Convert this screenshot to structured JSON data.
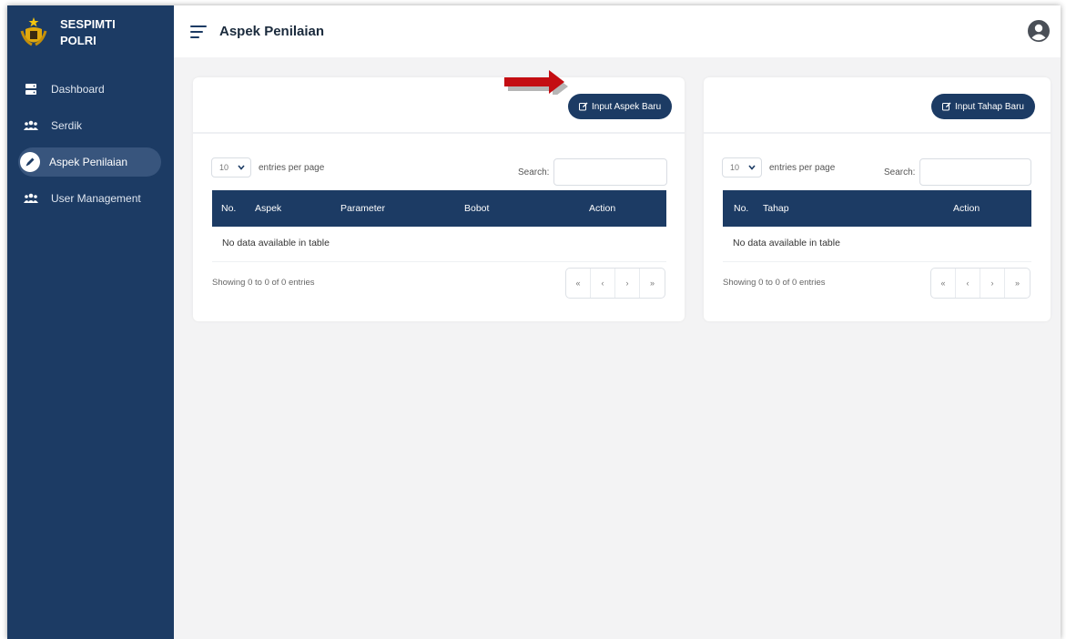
{
  "brand": {
    "line1": "SESPIMTI",
    "line2": "POLRI"
  },
  "header": {
    "title": "Aspek Penilaian"
  },
  "sidebar": {
    "items": [
      {
        "label": "Dashboard",
        "icon": "server-icon"
      },
      {
        "label": "Serdik",
        "icon": "users-icon"
      },
      {
        "label": "Aspek Penilaian",
        "icon": "pen-icon",
        "active": true
      },
      {
        "label": "User Management",
        "icon": "users-icon"
      }
    ]
  },
  "aspek_card": {
    "button_label": "Input Aspek Baru",
    "length_value": "10",
    "length_suffix": "entries per page",
    "search_label": "Search:",
    "columns": [
      "No.",
      "Aspek",
      "Parameter",
      "Bobot",
      "Action"
    ],
    "empty_text": "No data available in table",
    "info_text": "Showing 0 to 0 of 0 entries",
    "pager": [
      "«",
      "‹",
      "›",
      "»"
    ]
  },
  "tahap_card": {
    "button_label": "Input Tahap Baru",
    "length_value": "10",
    "length_suffix": "entries per page",
    "search_label": "Search:",
    "columns": [
      "No.",
      "Tahap",
      "Action"
    ],
    "empty_text": "No data available in table",
    "info_text": "Showing 0 to 0 of 0 entries",
    "pager": [
      "«",
      "‹",
      "›",
      "»"
    ]
  },
  "colors": {
    "navy": "#1c3b64",
    "annotation_arrow": "#c40d12",
    "background": "#f3f3f4"
  }
}
